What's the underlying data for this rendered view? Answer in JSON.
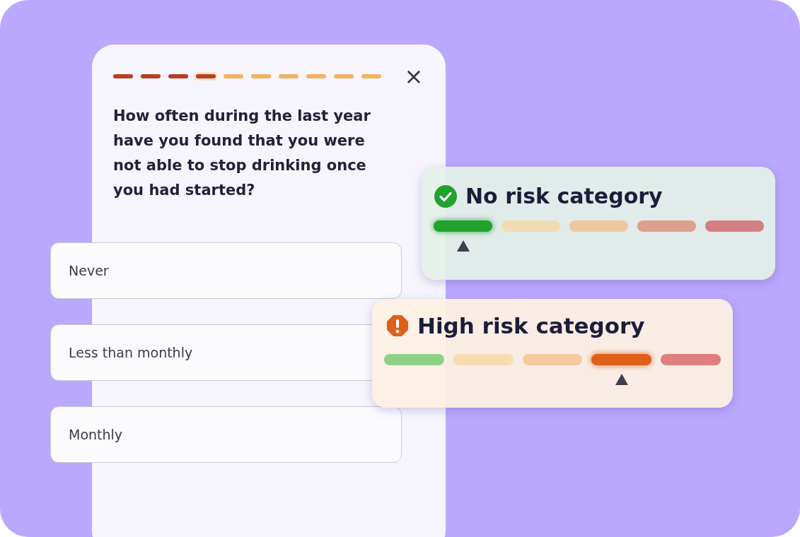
{
  "progress": [
    {
      "done": true,
      "selected": false
    },
    {
      "done": true,
      "selected": false
    },
    {
      "done": true,
      "selected": false
    },
    {
      "done": true,
      "selected": true
    },
    {
      "done": false,
      "selected": false
    },
    {
      "done": false,
      "selected": false
    },
    {
      "done": false,
      "selected": false
    },
    {
      "done": false,
      "selected": false
    },
    {
      "done": false,
      "selected": false
    },
    {
      "done": false,
      "selected": false
    }
  ],
  "close": "×",
  "question": "How often during the last year have you found that you were not able to stop drinking once you had started?",
  "options": [
    {
      "label": "Never"
    },
    {
      "label": "Less than monthly"
    },
    {
      "label": "Monthly"
    }
  ],
  "risk_cards": [
    {
      "kind": "ok",
      "title": "No risk category",
      "segments": [
        {
          "color": "#1fa22e",
          "selected": true
        },
        {
          "color": "#f0dcb0",
          "selected": false
        },
        {
          "color": "#ecc79f",
          "selected": false
        },
        {
          "color": "#dca08e",
          "selected": false
        },
        {
          "color": "#d47f82",
          "selected": false
        }
      ]
    },
    {
      "kind": "high",
      "title": "High risk category",
      "segments": [
        {
          "color": "#8fd088",
          "selected": false
        },
        {
          "color": "#f6dcb0",
          "selected": false
        },
        {
          "color": "#f5c9a0",
          "selected": false
        },
        {
          "color": "#df5f1a",
          "selected": true
        },
        {
          "color": "#df7e7c",
          "selected": false
        }
      ]
    }
  ]
}
